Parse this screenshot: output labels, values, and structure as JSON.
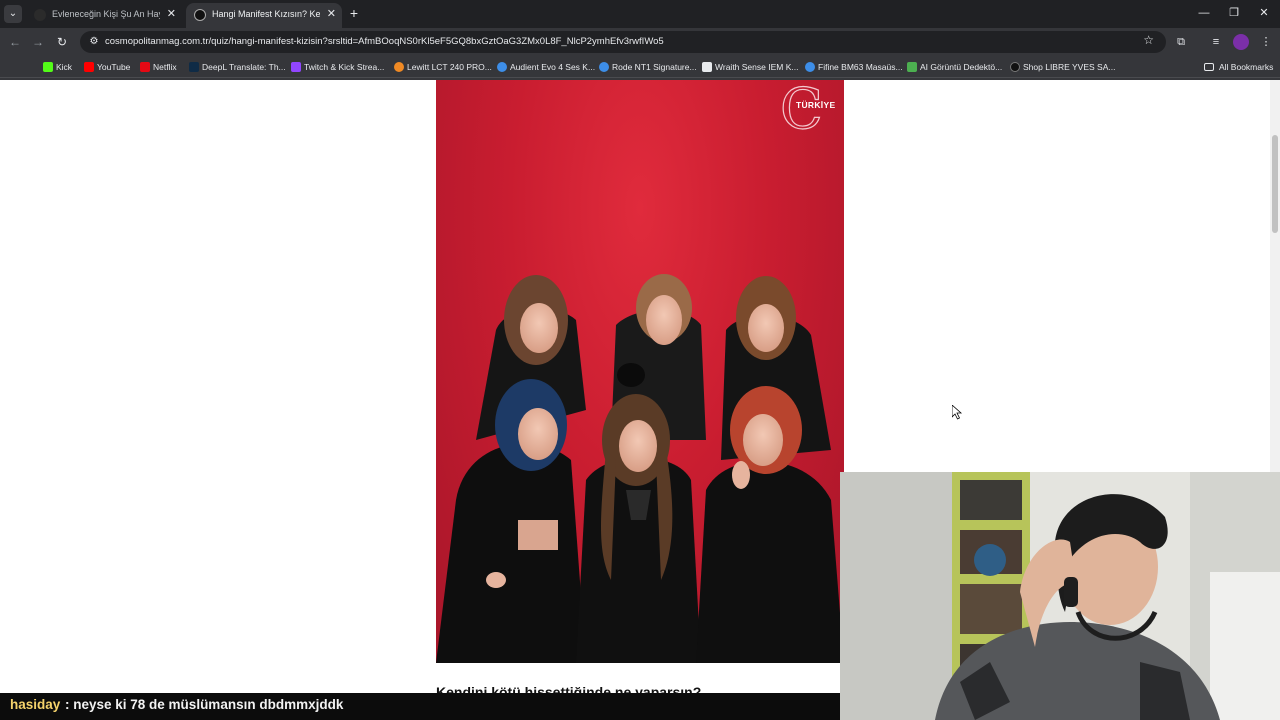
{
  "browser": {
    "tabs": [
      {
        "label": "Evleneceğin Kişi Şu An Hayatın...",
        "active": false,
        "favicon_color": "#2b2b2b"
      },
      {
        "label": "Hangi Manifest Kızısın? Kendini...",
        "active": true,
        "favicon_color": "#111111"
      }
    ],
    "url": "cosmopolitanmag.com.tr/quiz/hangi-manifest-kizisin?srsltid=AfmBOoqNS0rKl5eF5GQ8bxGztOaG3ZMx0L8F_NlcP2ymhEfv3rwfIWo5",
    "bookmarks": [
      {
        "label": "Kick",
        "color": "#53fc18"
      },
      {
        "label": "YouTube",
        "color": "#ff0000"
      },
      {
        "label": "Netflix",
        "color": "#e50914"
      },
      {
        "label": "DeepL Translate: Th...",
        "color": "#0f2b46"
      },
      {
        "label": "Twitch & Kick Strea...",
        "color": "#9146ff"
      },
      {
        "label": "Lewitt LCT 240 PRO...",
        "color": "#f08a24"
      },
      {
        "label": "Audient Evo 4 Ses K...",
        "color": "#3d8ee8"
      },
      {
        "label": "Rode NT1 Signature...",
        "color": "#3d8ee8"
      },
      {
        "label": "Wraith Sense IEM K...",
        "color": "#e8eaed"
      },
      {
        "label": "Fifine BM63 Masaüs...",
        "color": "#3d8ee8"
      },
      {
        "label": "AI Görüntü Dedektö...",
        "color": "#4caf50"
      },
      {
        "label": "Shop LIBRE YVES SA...",
        "color": "#111111"
      }
    ],
    "all_bookmarks": "All Bookmarks"
  },
  "page": {
    "brand_logo": "C",
    "brand_country": "TÜRKİYE",
    "next_question": "Kendini kötü hissettiğinde ne yaparsın?"
  },
  "chat": {
    "user": "hasiday",
    "message": ": neyse ki 78 de müslümansın dbdmmxjddk",
    "user_color": "#f4d26b"
  },
  "icons": {
    "tab_menu": "chevron-down-icon",
    "back": "arrow-left-icon",
    "forward": "arrow-right-icon",
    "reload": "reload-icon",
    "bookmark_star": "star-icon",
    "extensions": "puzzle-icon",
    "media": "media-control-icon",
    "menu": "kebab-menu-icon"
  }
}
